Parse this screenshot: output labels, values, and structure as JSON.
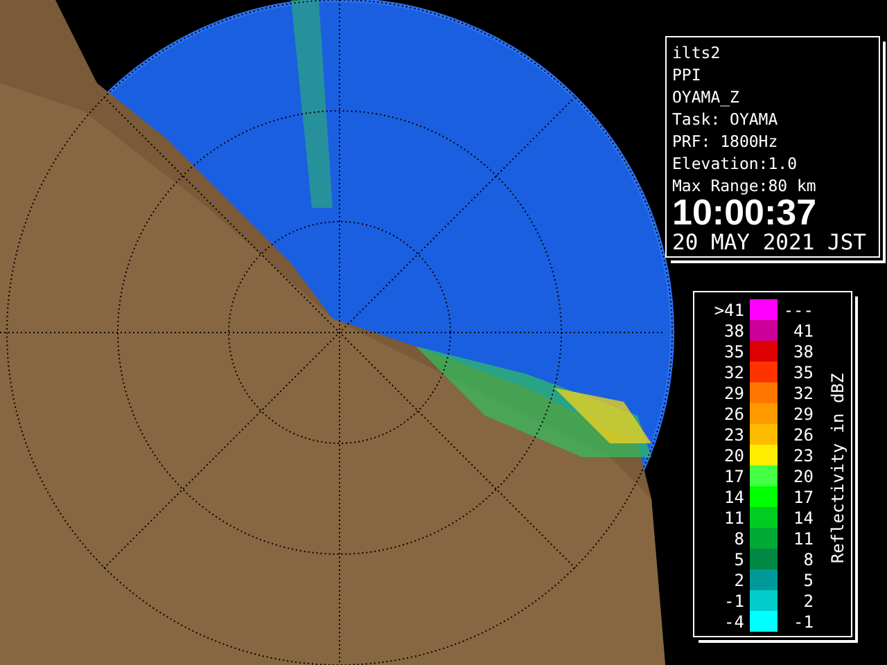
{
  "info_panel": {
    "lines": [
      "ilts2",
      "PPI",
      "OYAMA_Z",
      "Task: OYAMA",
      "PRF: 1800Hz",
      "Elevation:1.0",
      "Max Range:80 km"
    ],
    "time": "10:00:37",
    "date": "20 MAY 2021 JST"
  },
  "legend": {
    "title": "Reflectivity in dBZ",
    "rows": [
      {
        "low": ">41",
        "high": "---",
        "color": "#ff00ff"
      },
      {
        "low": "38",
        "high": "41",
        "color": "#cc0099"
      },
      {
        "low": "35",
        "high": "38",
        "color": "#dd0000"
      },
      {
        "low": "32",
        "high": "35",
        "color": "#ff3300"
      },
      {
        "low": "29",
        "high": "32",
        "color": "#ff7700"
      },
      {
        "low": "26",
        "high": "29",
        "color": "#ff9900"
      },
      {
        "low": "23",
        "high": "26",
        "color": "#ffbb00"
      },
      {
        "low": "20",
        "high": "23",
        "color": "#ffee00"
      },
      {
        "low": "17",
        "high": "20",
        "color": "#44ff44"
      },
      {
        "low": "14",
        "high": "17",
        "color": "#00ff00"
      },
      {
        "low": "11",
        "high": "14",
        "color": "#00cc22"
      },
      {
        "low": "8",
        "high": "11",
        "color": "#00aa33"
      },
      {
        "low": "5",
        "high": "8",
        "color": "#008844"
      },
      {
        "low": "2",
        "high": "5",
        "color": "#009999"
      },
      {
        "low": "-1",
        "high": "2",
        "color": "#00cccc"
      },
      {
        "low": "-4",
        "high": "-1",
        "color": "#00ffff"
      }
    ]
  }
}
